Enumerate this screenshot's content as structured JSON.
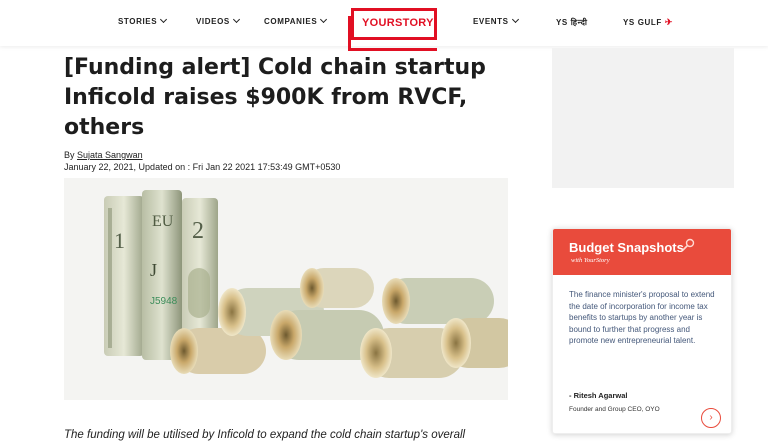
{
  "nav": {
    "items": [
      {
        "label": "STORIES",
        "dropdown": true
      },
      {
        "label": "VIDEOS",
        "dropdown": true
      },
      {
        "label": "COMPANIES",
        "dropdown": true
      },
      {
        "label": "EVENTS",
        "dropdown": true
      },
      {
        "label": "YS हिन्दी",
        "dropdown": false
      },
      {
        "label": "YS GULF",
        "dropdown": false
      }
    ],
    "logo_text": "YOURSTORY",
    "brand_color": "#e10f23"
  },
  "article": {
    "headline": "[Funding alert] Cold chain startup Inficold raises $900K from RVCF, others",
    "by_prefix": "By",
    "author": "Sujata Sangwan",
    "dates": "January 22, 2021,  Updated on : Fri Jan 22 2021 17:53:49 GMT+0530",
    "lead": "The funding will be utilised by Inficold to expand the cold chain startup's overall"
  },
  "sidebar": {
    "card": {
      "title": "Budget Snapshots",
      "subtitle": "with YourStory",
      "quote": "The finance minister's proposal to extend the date of incorporation for income tax benefits to startups by another year is bound to further that progress and promote new entrepreneurial talent.",
      "author": "- Ritesh Agarwal",
      "role": "Founder and Group CEO, OYO",
      "next_icon": "chevron-right-icon",
      "accent": "#e94b3c"
    }
  }
}
